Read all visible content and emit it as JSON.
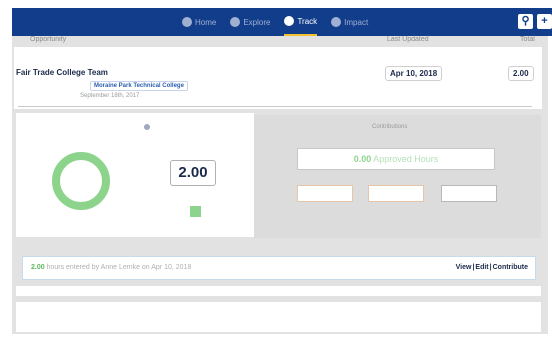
{
  "nav": {
    "home": "Home",
    "explore": "Explore",
    "track": "Track",
    "impact": "Impact"
  },
  "header": {
    "opportunity": "Opportunity",
    "last_updated": "Last Updated",
    "total": "Total"
  },
  "opportunity": {
    "title": "Fair Trade College Team",
    "organization": "Moraine Park Technical College",
    "start_date": "September 18th, 2017",
    "last_updated": "Apr 10, 2018",
    "total": "2.00"
  },
  "summary": {
    "big_total": "2.00"
  },
  "contributions": {
    "heading": "Contributions",
    "approved_value": "0.00",
    "approved_label": "Approved Hours"
  },
  "entry": {
    "hours": "2.00",
    "text": "hours entered by Anne Lemke on Apr 10, 2018",
    "view": "View",
    "edit": "Edit",
    "contribute": "Contribute"
  },
  "colors": {
    "nav_bg": "#123d8a",
    "accent_green": "#8cd48c",
    "active_underline": "#f2c12e"
  }
}
